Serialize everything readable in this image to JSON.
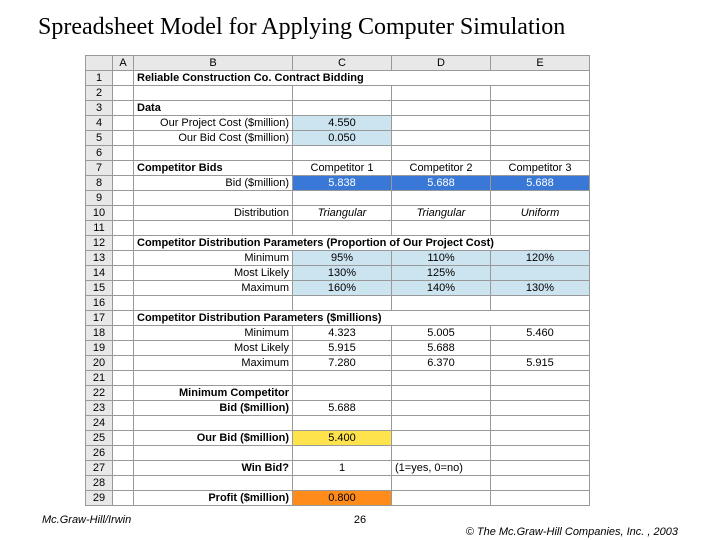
{
  "title": "Spreadsheet Model for Applying Computer Simulation",
  "columns": [
    "",
    "A",
    "B",
    "C",
    "D",
    "E"
  ],
  "rows": [
    {
      "n": "1",
      "b": "Reliable Construction Co. Contract Bidding",
      "bold": true,
      "left": true,
      "span": true
    },
    {
      "n": "2"
    },
    {
      "n": "3",
      "b": "Data",
      "bold": true,
      "left": true
    },
    {
      "n": "4",
      "b": "Our Project Cost ($million)",
      "c": "4.550",
      "c_cls": "bg-pale"
    },
    {
      "n": "5",
      "b": "Our Bid Cost ($million)",
      "c": "0.050",
      "c_cls": "bg-pale"
    },
    {
      "n": "6"
    },
    {
      "n": "7",
      "b": "Competitor Bids",
      "bold": true,
      "left": true,
      "c": "Competitor 1",
      "d": "Competitor 2",
      "e": "Competitor 3"
    },
    {
      "n": "8",
      "b": "Bid ($million)",
      "c": "5.838",
      "d": "5.688",
      "e": "5.688",
      "row_cls": "bg-blue"
    },
    {
      "n": "9"
    },
    {
      "n": "10",
      "b": "Distribution",
      "c": "Triangular",
      "d": "Triangular",
      "e": "Uniform",
      "italic": true
    },
    {
      "n": "11"
    },
    {
      "n": "12",
      "b": "Competitor Distribution Parameters (Proportion of Our Project Cost)",
      "bold": true,
      "left": true,
      "span": true
    },
    {
      "n": "13",
      "b": "Minimum",
      "c": "95%",
      "d": "110%",
      "e": "120%",
      "row_cls": "bg-pale"
    },
    {
      "n": "14",
      "b": "Most Likely",
      "c": "130%",
      "d": "125%",
      "row_cls": "bg-pale"
    },
    {
      "n": "15",
      "b": "Maximum",
      "c": "160%",
      "d": "140%",
      "e": "130%",
      "row_cls": "bg-pale"
    },
    {
      "n": "16"
    },
    {
      "n": "17",
      "b": "Competitor Distribution Parameters ($millions)",
      "bold": true,
      "left": true,
      "span": true
    },
    {
      "n": "18",
      "b": "Minimum",
      "c": "4.323",
      "d": "5.005",
      "e": "5.460"
    },
    {
      "n": "19",
      "b": "Most Likely",
      "c": "5.915",
      "d": "5.688"
    },
    {
      "n": "20",
      "b": "Maximum",
      "c": "7.280",
      "d": "6.370",
      "e": "5.915"
    },
    {
      "n": "21"
    },
    {
      "n": "22",
      "b": "Minimum Competitor",
      "bold": true
    },
    {
      "n": "23",
      "b": "Bid ($million)",
      "bold": true,
      "c": "5.688"
    },
    {
      "n": "24"
    },
    {
      "n": "25",
      "b": "Our Bid ($million)",
      "bold": true,
      "c": "5.400",
      "c_cls": "bg-yellow"
    },
    {
      "n": "26"
    },
    {
      "n": "27",
      "b": "Win Bid?",
      "bold": true,
      "c": "1",
      "d": "(1=yes, 0=no)",
      "d_left": true
    },
    {
      "n": "28"
    },
    {
      "n": "29",
      "b": "Profit ($million)",
      "bold": true,
      "c": "0.800",
      "c_cls": "bg-orange"
    }
  ],
  "footer": {
    "left": "Mc.Graw-Hill/Irwin",
    "center": "26",
    "right": "© The Mc.Graw-Hill Companies, Inc. , 2003"
  }
}
